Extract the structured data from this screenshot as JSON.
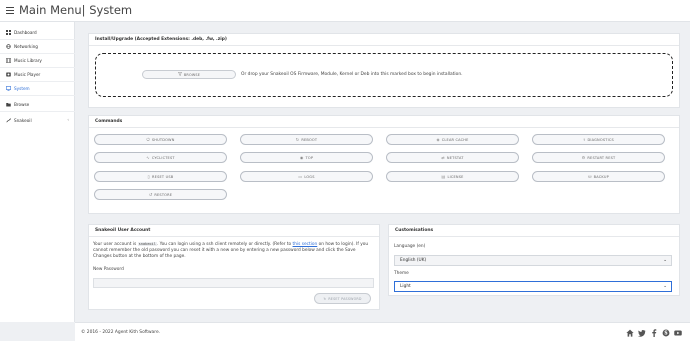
{
  "header": {
    "title": "Main Menu| System"
  },
  "sidebar": {
    "items": [
      {
        "label": "Dashboard",
        "icon": "grid-icon"
      },
      {
        "label": "Networking",
        "icon": "globe-icon"
      },
      {
        "label": "Music Library",
        "icon": "library-icon"
      },
      {
        "label": "Music Player",
        "icon": "music-icon"
      },
      {
        "label": "System",
        "icon": "monitor-icon",
        "active": true
      },
      {
        "label": "Browse",
        "icon": "folder-icon"
      },
      {
        "label": "Snakeoil",
        "icon": "snake-icon",
        "chevron": "‹"
      }
    ]
  },
  "install": {
    "title": "Install/Upgrade (Accepted Extensions: .deb, .fw, .zip)",
    "browse_label": "BROWSE",
    "drop_text": "Or drop your Snakeoil OS Firmware, Module, Kernel or Deb into this marked box to begin installation."
  },
  "commands": {
    "title": "Commands",
    "buttons": [
      {
        "label": "SHUTDOWN",
        "icon": "power-icon"
      },
      {
        "label": "REBOOT",
        "icon": "refresh-icon"
      },
      {
        "label": "CLEAR CACHE",
        "icon": "eraser-icon"
      },
      {
        "label": "DIAGNOSTICS",
        "icon": "stethoscope-icon"
      },
      {
        "label": "CYCLICTEST",
        "icon": "chart-icon"
      },
      {
        "label": "TOP",
        "icon": "gauge-icon"
      },
      {
        "label": "NETSTAT",
        "icon": "network-icon"
      },
      {
        "label": "RESTART REST",
        "icon": "gear-icon"
      },
      {
        "label": "RESET USB",
        "icon": "usb-icon"
      },
      {
        "label": "LOGS",
        "icon": "terminal-icon"
      },
      {
        "label": "LICENSE",
        "icon": "license-icon"
      },
      {
        "label": "BACKUP",
        "icon": "backup-icon"
      },
      {
        "label": "RESTORE",
        "icon": "restore-icon"
      }
    ]
  },
  "account": {
    "title": "Snakeoil User Account",
    "text_1": "Your user account is ",
    "username": "snakeoil",
    "text_2": ". You can login using a ssh client remotely or directly. (Refer to ",
    "link": "this section",
    "text_3": " on how to login). If you cannot remember the old password you can reset it with a new one by entering a new password below and click the Save Changes button at the bottom of the page.",
    "password_label": "New Password",
    "password_value": "",
    "reset_label": "RESET PASSWORD"
  },
  "customisations": {
    "title": "Customisations",
    "language_label": "Language (en)",
    "language_value": "English (UK)",
    "theme_label": "Theme",
    "theme_value": "Light"
  },
  "footer": {
    "copyright": "© 2016 - 2022 Agent Kith Software.",
    "icons": [
      "home-icon",
      "twitter-icon",
      "facebook-icon",
      "skype-icon",
      "youtube-icon"
    ]
  },
  "colors": {
    "accent": "#2f6fd8",
    "background": "#eef0f3"
  }
}
